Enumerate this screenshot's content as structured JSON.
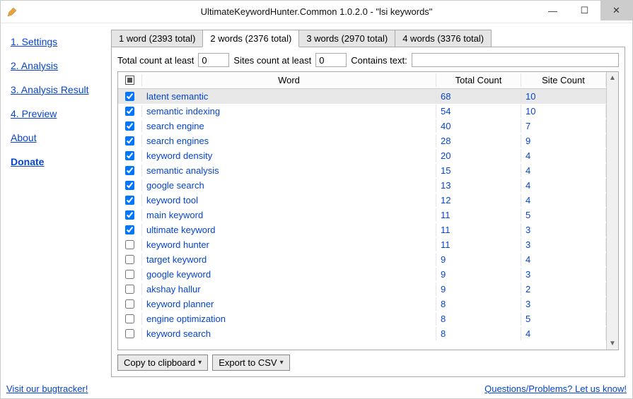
{
  "window": {
    "title": "UltimateKeywordHunter.Common 1.0.2.0 - \"lsi keywords\""
  },
  "sidebar": {
    "items": [
      {
        "label": "1. Settings"
      },
      {
        "label": "2. Analysis"
      },
      {
        "label": "3. Analysis Result"
      },
      {
        "label": "4. Preview"
      },
      {
        "label": "About"
      },
      {
        "label": "Donate"
      }
    ]
  },
  "tabs": [
    {
      "label": "1 word (2393 total)"
    },
    {
      "label": "2 words (2376 total)"
    },
    {
      "label": "3 words (2970 total)"
    },
    {
      "label": "4 words (3376 total)"
    }
  ],
  "filters": {
    "total_label": "Total count at least",
    "total_value": "0",
    "sites_label": "Sites count at least",
    "sites_value": "0",
    "contains_label": "Contains text:",
    "contains_value": ""
  },
  "columns": {
    "word": "Word",
    "total": "Total Count",
    "site": "Site Count"
  },
  "rows": [
    {
      "checked": true,
      "word": "latent semantic",
      "total": "68",
      "site": "10",
      "selected": true
    },
    {
      "checked": true,
      "word": "semantic indexing",
      "total": "54",
      "site": "10"
    },
    {
      "checked": true,
      "word": "search engine",
      "total": "40",
      "site": "7"
    },
    {
      "checked": true,
      "word": "search engines",
      "total": "28",
      "site": "9"
    },
    {
      "checked": true,
      "word": "keyword density",
      "total": "20",
      "site": "4"
    },
    {
      "checked": true,
      "word": "semantic analysis",
      "total": "15",
      "site": "4"
    },
    {
      "checked": true,
      "word": "google search",
      "total": "13",
      "site": "4"
    },
    {
      "checked": true,
      "word": "keyword tool",
      "total": "12",
      "site": "4"
    },
    {
      "checked": true,
      "word": "main keyword",
      "total": "11",
      "site": "5"
    },
    {
      "checked": true,
      "word": "ultimate keyword",
      "total": "11",
      "site": "3"
    },
    {
      "checked": false,
      "word": "keyword hunter",
      "total": "11",
      "site": "3"
    },
    {
      "checked": false,
      "word": "target keyword",
      "total": "9",
      "site": "4"
    },
    {
      "checked": false,
      "word": "google keyword",
      "total": "9",
      "site": "3"
    },
    {
      "checked": false,
      "word": "akshay hallur",
      "total": "9",
      "site": "2"
    },
    {
      "checked": false,
      "word": "keyword planner",
      "total": "8",
      "site": "3"
    },
    {
      "checked": false,
      "word": "engine optimization",
      "total": "8",
      "site": "5"
    },
    {
      "checked": false,
      "word": "keyword search",
      "total": "8",
      "site": "4"
    }
  ],
  "actions": {
    "copy": "Copy to clipboard",
    "export": "Export to CSV"
  },
  "footer": {
    "left": "Visit our bugtracker!",
    "right": "Questions/Problems? Let us know!"
  }
}
